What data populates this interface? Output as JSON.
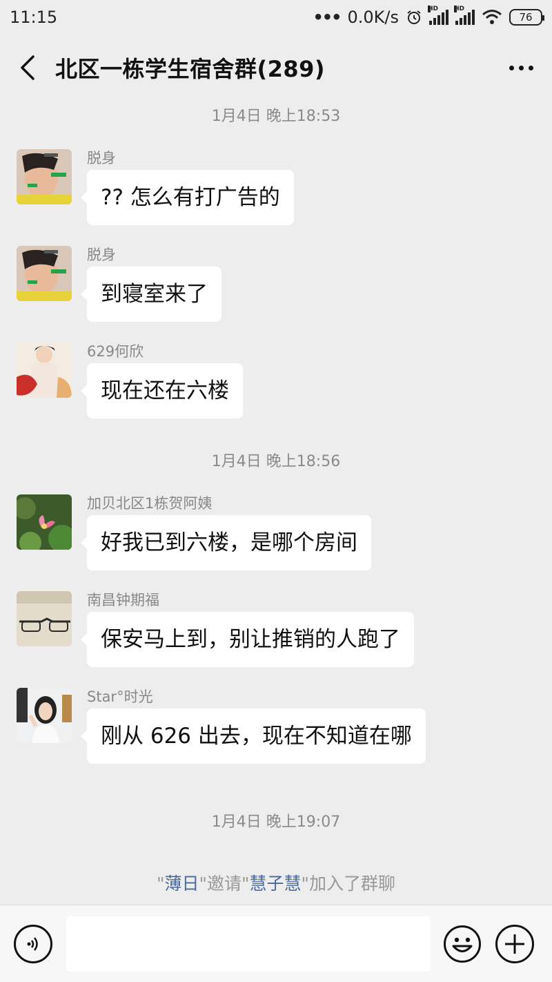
{
  "status_bar": {
    "time": "11:15",
    "dots": "•••",
    "net_speed": "0.0K/s",
    "battery": "76",
    "hd_label": "HD",
    "icons": [
      "alarm-icon",
      "signal-icon",
      "signal-icon",
      "wifi-icon",
      "battery-icon"
    ]
  },
  "header": {
    "title": "北区一栋学生宿舍群(289)"
  },
  "chat": {
    "separators": [
      "1月4日 晚上18:53",
      "1月4日 晚上18:56",
      "1月4日 晚上19:07"
    ],
    "messages": [
      {
        "sender": "脱身",
        "text": "?? 怎么有打广告的"
      },
      {
        "sender": "脱身",
        "text": "到寝室来了"
      },
      {
        "sender": "629何欣",
        "text": "现在还在六楼"
      },
      {
        "sender": "加贝北区1栋贺阿姨",
        "text": "好我已到六楼，是哪个房间"
      },
      {
        "sender": "南昌钟期福",
        "text": "保安马上到，别让推销的人跑了"
      },
      {
        "sender": "Star°时光",
        "text": "刚从 626 出去，现在不知道在哪"
      }
    ],
    "system_notice": {
      "q1": "\"",
      "inviter": "薄日",
      "q2": "\"邀请\"",
      "invitee": "慧子慧",
      "q3": "\"加入了群聊"
    }
  },
  "input_bar": {
    "placeholder": "",
    "icons": [
      "voice-icon",
      "emoji-icon",
      "plus-icon"
    ]
  },
  "colors": {
    "background": "#ededed",
    "bubble": "#ffffff",
    "link_name": "#4a6a9a",
    "meta_text": "#888888"
  }
}
